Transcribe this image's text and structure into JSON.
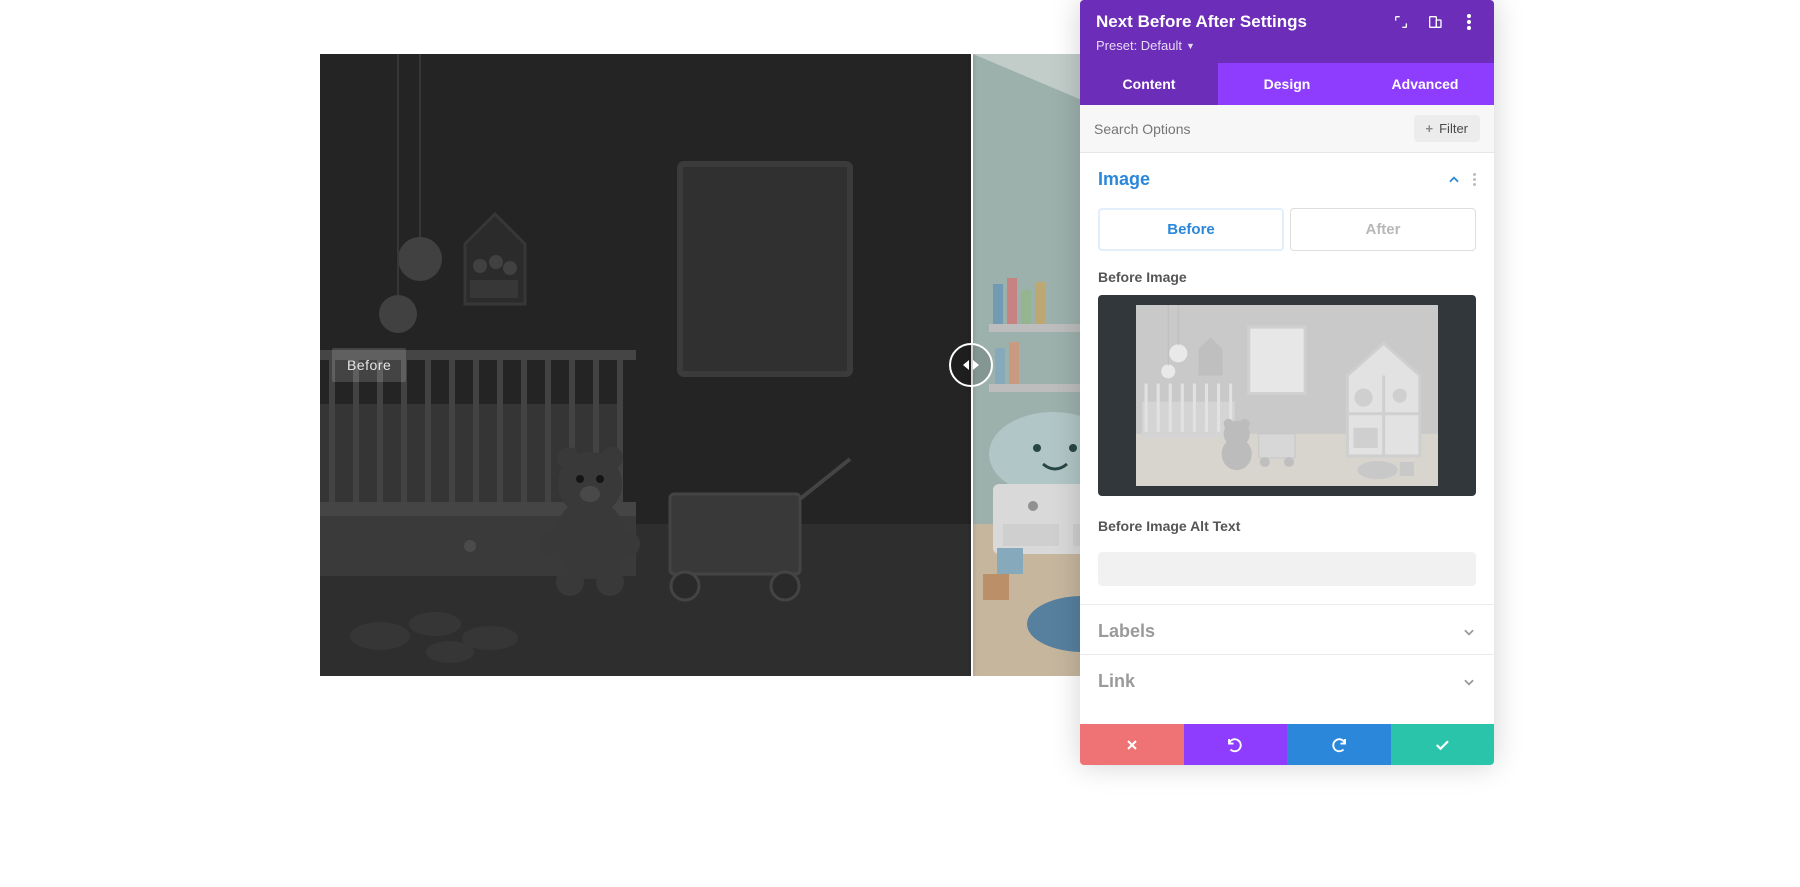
{
  "panel": {
    "title": "Next Before After Settings",
    "preset_label": "Preset: Default"
  },
  "tabs": {
    "content": "Content",
    "design": "Design",
    "advanced": "Advanced"
  },
  "search": {
    "placeholder": "Search Options",
    "filter_label": "Filter"
  },
  "sections": {
    "image": {
      "title": "Image",
      "subtab_before": "Before",
      "subtab_after": "After",
      "before_image_label": "Before Image",
      "alt_text_label": "Before Image Alt Text",
      "alt_text_value": ""
    },
    "labels": {
      "title": "Labels"
    },
    "link": {
      "title": "Link"
    }
  },
  "preview": {
    "before_badge": "Before"
  },
  "colors": {
    "header": "#6c2eb9",
    "accent": "#8e3dff",
    "link": "#2b87da",
    "save": "#29c4a9",
    "cancel": "#ef7374"
  },
  "icons": {
    "expand": "expand-icon",
    "responsive": "responsive-icon",
    "more": "more-icon",
    "chevron_up": "chevron-up-icon",
    "chevron_down": "chevron-down-icon",
    "close": "close-icon",
    "undo": "undo-icon",
    "redo": "redo-icon",
    "check": "check-icon",
    "plus": "plus-icon",
    "slider_handle": "slider-handle-icon"
  }
}
